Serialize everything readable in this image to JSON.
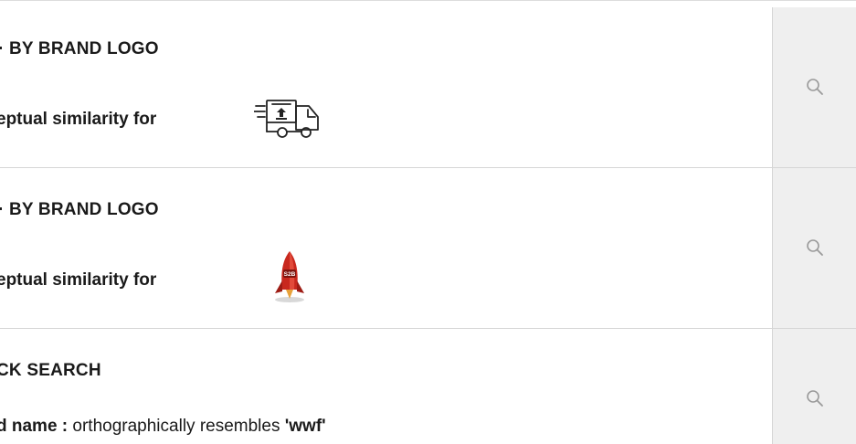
{
  "results": [
    {
      "title": "BY BRAND LOGO",
      "description": "eptual similarity for",
      "logo_icon": "delivery-truck-logo"
    },
    {
      "title": "BY BRAND LOGO",
      "description": "eptual similarity for",
      "logo_icon": "rocket-logo",
      "logo_text": "S2B"
    },
    {
      "title": "CK SEARCH",
      "description_label": "d name :",
      "description_text": " orthographically resembles ",
      "description_term": "'wwf'"
    }
  ],
  "action_icon": "search-icon",
  "colors": {
    "action_bg": "#efefef",
    "divider": "#d6d6d6",
    "icon": "#9a9a9a",
    "rocket_red": "#c8281e"
  }
}
